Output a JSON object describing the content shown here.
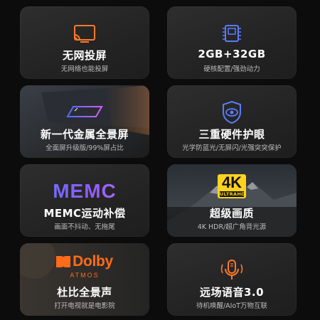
{
  "colors": {
    "accent_orange": "#ff6b1a",
    "accent_blue": "#4f6cff",
    "accent_purple": "#9a5cff",
    "badge_yellow": "#ffd21f"
  },
  "cards": [
    {
      "title": "无网投屏",
      "subtitle": "无网络也能投屏",
      "icon": "screen-cast-icon"
    },
    {
      "title": "2GB+32GB",
      "subtitle": "硬核配置/强劲动力",
      "icon": "chip-icon"
    },
    {
      "title": "新一代金属全景屏",
      "subtitle": "全面屏升级版/99%屏占比",
      "icon": "panel-screen-icon"
    },
    {
      "title": "三重硬件护眼",
      "subtitle": "光学防蓝光/无屏闪/光强突突保护",
      "icon": "shield-eye-icon"
    },
    {
      "title": "MEMC运动补偿",
      "subtitle": "画面不抖动、无拖尾",
      "logo": "MEMC"
    },
    {
      "title": "超级画质",
      "subtitle": "4K HDR/超广角背光源",
      "badge_big": "4K",
      "badge_small": "ULTRAHD"
    },
    {
      "title": "杜比全景声",
      "subtitle": "打开电视就是电影院",
      "logo_word": "Dolby",
      "logo_sub": "ATMOS"
    },
    {
      "title": "远场语音3.0",
      "subtitle": "待机唤醒/AIoT万物互联",
      "icon": "microphone-icon"
    }
  ]
}
